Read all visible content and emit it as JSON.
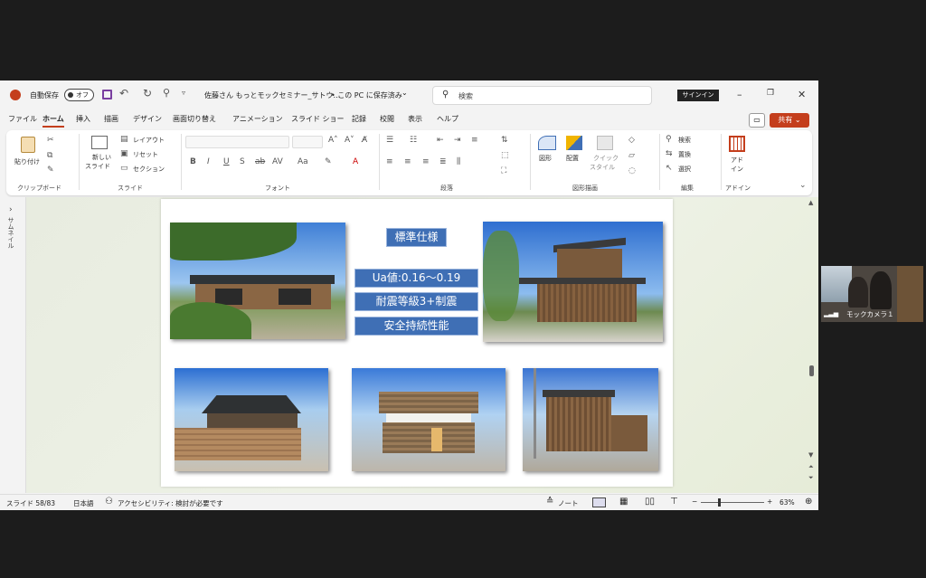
{
  "titlebar": {
    "autosave_label": "自動保存",
    "autosave_state": "オフ",
    "document_title": "佐藤さん もっとモックセミナー_サトウ…",
    "save_location": "• この PC に保存済み",
    "search_placeholder": "検索",
    "signin_label": "サインイン"
  },
  "menu_tabs": [
    "ファイル",
    "ホーム",
    "挿入",
    "描画",
    "デザイン",
    "画面切り替え",
    "アニメーション",
    "スライド ショー",
    "記録",
    "校閲",
    "表示",
    "ヘルプ"
  ],
  "share_label": "共有",
  "ribbon": {
    "clipboard": {
      "paste": "貼り付け",
      "group": "クリップボード"
    },
    "slides": {
      "new_slide_1": "新しい",
      "new_slide_2": "スライド",
      "layout": "レイアウト",
      "reset": "リセット",
      "section": "セクション",
      "group": "スライド"
    },
    "font": {
      "group": "フォント"
    },
    "paragraph": {
      "group": "段落"
    },
    "drawing": {
      "shapes": "図形",
      "arrange": "配置",
      "quick_style_1": "クイック",
      "quick_style_2": "スタイル",
      "group": "図形描画"
    },
    "editing": {
      "find": "検索",
      "replace": "置換",
      "select": "選択",
      "group": "編集"
    },
    "addins": {
      "addin_1": "アド",
      "addin_2": "イン",
      "group": "アドイン"
    }
  },
  "left_panel": {
    "thumbnails": "サムネイル"
  },
  "slide": {
    "box1": "標準仕様",
    "box2": "Ua値:0.16～0.19",
    "box3": "耐震等級3+制震",
    "box4": "安全持続性能"
  },
  "status": {
    "slide_number": "スライド 58/83",
    "language": "日本語",
    "accessibility": "アクセシビリティ: 検討が必要です",
    "notes": "ノート",
    "zoom": "63%"
  },
  "camera": {
    "label": "モックカメラ１"
  },
  "colors": {
    "accent": "#c43e1c",
    "slide_box": "#3f6fb5"
  }
}
